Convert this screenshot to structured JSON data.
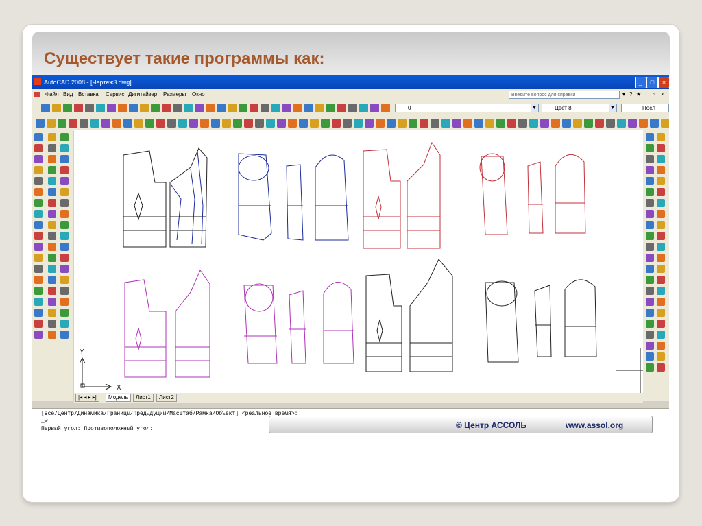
{
  "slide": {
    "title": "Существует такие программы как:"
  },
  "window": {
    "title": "AutoCAD 2008 - [Чертеж3.dwg]",
    "controls": {
      "minimize": "_",
      "maximize": "□",
      "close": "×"
    }
  },
  "menu": {
    "items": [
      "Файл",
      "Вид",
      "Вставка",
      "Сервис",
      "Дигитайзер",
      "Размеры",
      "Окно"
    ],
    "help_placeholder": "Введите вопрос для справки"
  },
  "toolbar": {
    "layer_value": "0",
    "color_value": "Цвет 8",
    "linetype_value": "Посл"
  },
  "layout_tabs": [
    "Модель",
    "Лист1",
    "Лист2"
  ],
  "ucs": {
    "x_label": "X",
    "y_label": "Y"
  },
  "command": {
    "lines": [
      "[Все/Центр/Динамика/Границы/Предыдущий/Масштаб/Рамка/Объект] <реальное время>:",
      "_w",
      "Первый угол: Противоположный угол:"
    ]
  },
  "watermark": {
    "org": "© Центр АССОЛЬ",
    "url": "www.assol.org"
  },
  "colors": {
    "title_text": "#a4582c",
    "window_titlebar": "#0a5ad8",
    "pattern_black": "#222222",
    "pattern_blue": "#1c2a9a",
    "pattern_red": "#c0303a",
    "pattern_magenta": "#b030b8"
  }
}
